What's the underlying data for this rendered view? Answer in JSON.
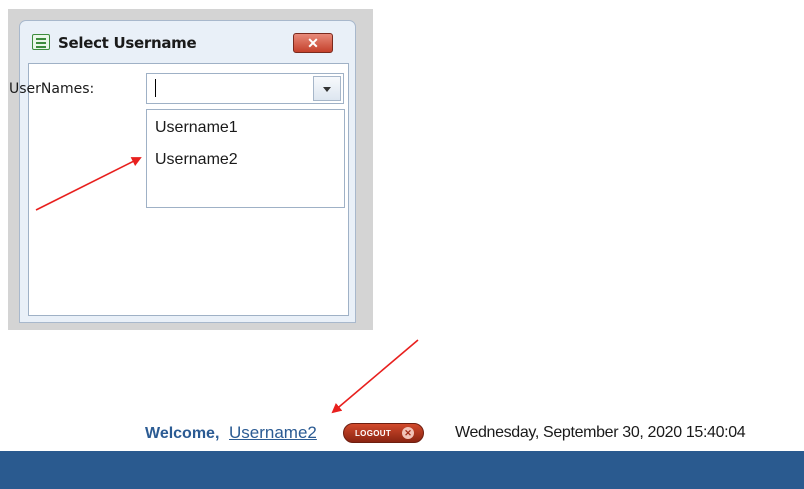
{
  "dialog": {
    "title": "Select Username",
    "close_icon": "close-icon",
    "field_label": "UserNames:",
    "combo_value": "",
    "options": [
      "Username1",
      "Username2"
    ]
  },
  "header": {
    "welcome": "Welcome,",
    "username": "Username2",
    "logout_label": "LOGOUT",
    "datetime": "Wednesday, September 30, 2020 15:40:04"
  },
  "colors": {
    "accent": "#2b5b93",
    "bar": "#2a5a8f",
    "logout": "#b23a22",
    "arrow": "#e8201e"
  }
}
